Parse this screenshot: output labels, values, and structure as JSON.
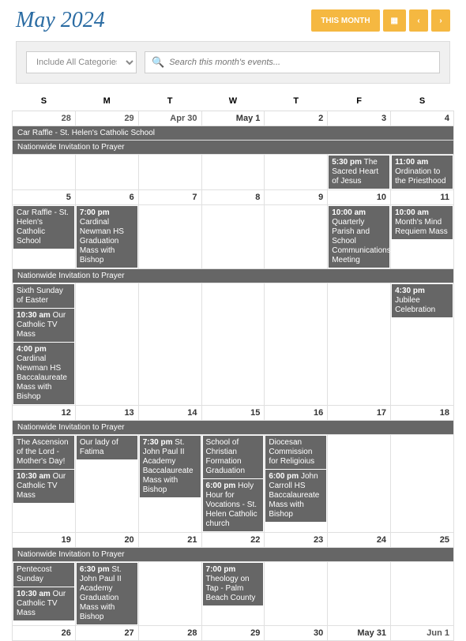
{
  "title": "May 2024",
  "buttons": {
    "thisMonth": "THIS MONTH"
  },
  "filter": {
    "category": "Include All Categories",
    "searchPlaceholder": "Search this month's events..."
  },
  "dow": [
    "S",
    "M",
    "T",
    "W",
    "T",
    "F",
    "S"
  ],
  "weeks": [
    {
      "days": [
        {
          "num": "28",
          "other": true
        },
        {
          "num": "29",
          "other": true
        },
        {
          "num": "Apr 30",
          "other": true
        },
        {
          "num": "May 1"
        },
        {
          "num": "2"
        },
        {
          "num": "3"
        },
        {
          "num": "4"
        }
      ],
      "spans": [
        {
          "start": 0,
          "end": 6,
          "text": "Car Raffle - St. Helen's Catholic School"
        },
        {
          "start": 0,
          "end": 6,
          "text": "Nationwide Invitation to Prayer"
        }
      ],
      "cellEvents": {
        "5": [
          {
            "time": "5:30 pm",
            "title": "The Sacred Heart of Jesus"
          }
        ],
        "6": [
          {
            "time": "11:00 am",
            "title": "Ordination to the Priesthood"
          }
        ]
      }
    },
    {
      "days": [
        {
          "num": "5"
        },
        {
          "num": "6"
        },
        {
          "num": "7"
        },
        {
          "num": "8"
        },
        {
          "num": "9"
        },
        {
          "num": "10"
        },
        {
          "num": "11"
        }
      ],
      "spans": [],
      "cellEvents": {
        "0": [
          {
            "time": "",
            "title": "Car Raffle - St. Helen's Catholic School"
          }
        ],
        "1": [
          {
            "time": "7:00 pm",
            "title": "Cardinal Newman HS Graduation Mass with Bishop"
          }
        ],
        "5": [
          {
            "time": "10:00 am",
            "title": "Quarterly Parish and School Communications Meeting"
          }
        ],
        "6": [
          {
            "time": "10:00 am",
            "title": "Month's Mind Requiem Mass"
          }
        ]
      },
      "spansAfter": [
        {
          "start": 0,
          "end": 6,
          "text": "Nationwide Invitation to Prayer"
        }
      ],
      "cellEventsAfter": {
        "0": [
          {
            "time": "",
            "title": "Sixth Sunday of Easter"
          },
          {
            "time": "10:30 am",
            "title": "Our Catholic TV Mass"
          },
          {
            "time": "4:00 pm",
            "title": "Cardinal Newman HS Baccalaureate Mass with Bishop"
          }
        ],
        "6": [
          {
            "time": "4:30 pm",
            "title": "Jubilee Celebration"
          }
        ]
      }
    },
    {
      "days": [
        {
          "num": "12"
        },
        {
          "num": "13"
        },
        {
          "num": "14"
        },
        {
          "num": "15"
        },
        {
          "num": "16"
        },
        {
          "num": "17"
        },
        {
          "num": "18"
        }
      ],
      "spans": [
        {
          "start": 0,
          "end": 6,
          "text": "Nationwide Invitation to Prayer"
        }
      ],
      "cellEvents": {
        "0": [
          {
            "time": "",
            "title": "The Ascension of the Lord - Mother's Day!"
          },
          {
            "time": "10:30 am",
            "title": "Our Catholic TV Mass"
          }
        ],
        "1": [
          {
            "time": "",
            "title": "Our lady of Fatima"
          }
        ],
        "2": [
          {
            "time": "7:30 pm",
            "title": "St. John Paul II Academy Baccalaureate Mass with Bishop"
          }
        ],
        "3": [
          {
            "time": "",
            "title": "School of Christian Formation Graduation"
          },
          {
            "time": "6:00 pm",
            "title": "Holy Hour for Vocations - St. Helen Catholic church"
          }
        ],
        "4": [
          {
            "time": "",
            "title": "Diocesan Commission for Religioius"
          },
          {
            "time": "6:00 pm",
            "title": "John Carroll HS Baccalaureate Mass with Bishop"
          }
        ]
      }
    },
    {
      "days": [
        {
          "num": "19"
        },
        {
          "num": "20"
        },
        {
          "num": "21"
        },
        {
          "num": "22"
        },
        {
          "num": "23"
        },
        {
          "num": "24"
        },
        {
          "num": "25"
        }
      ],
      "spans": [
        {
          "start": 0,
          "end": 6,
          "text": "Nationwide Invitation to Prayer"
        }
      ],
      "cellEvents": {
        "0": [
          {
            "time": "",
            "title": "Pentecost Sunday"
          },
          {
            "time": "10:30 am",
            "title": "Our Catholic TV Mass"
          }
        ],
        "1": [
          {
            "time": "6:30 pm",
            "title": "St. John Paul II Academy Graduation Mass with Bishop"
          }
        ],
        "3": [
          {
            "time": "7:00 pm",
            "title": "Theology on Tap - Palm Beach County"
          }
        ]
      }
    },
    {
      "days": [
        {
          "num": "26"
        },
        {
          "num": "27"
        },
        {
          "num": "28"
        },
        {
          "num": "29"
        },
        {
          "num": "30"
        },
        {
          "num": "May 31"
        },
        {
          "num": "Jun 1",
          "other": true
        }
      ],
      "spans": [],
      "cellEvents": {}
    }
  ]
}
